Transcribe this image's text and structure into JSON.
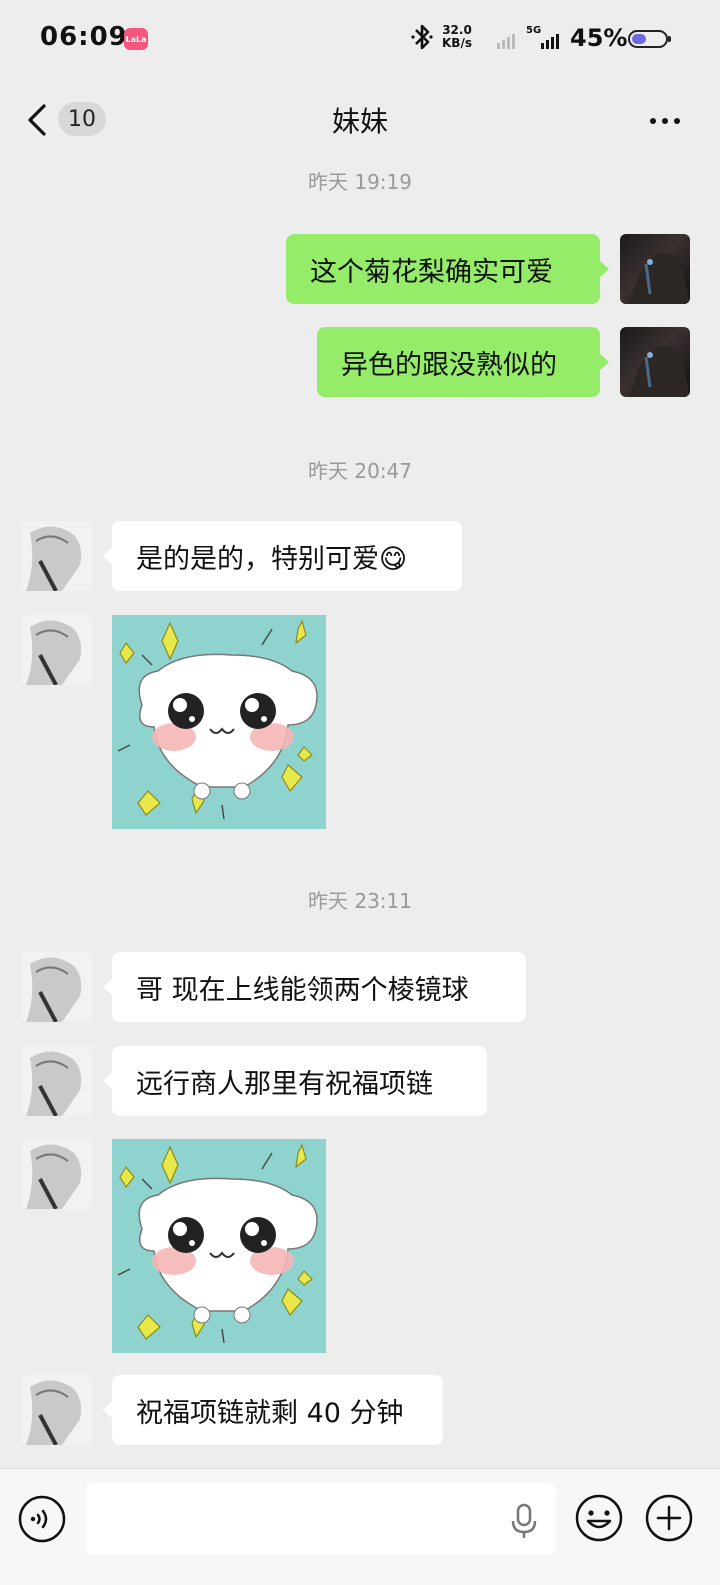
{
  "status_bar": {
    "time": "06:09",
    "app_badge": "LaLa",
    "speed_value": "32.0",
    "speed_unit": "KB/s",
    "network": "5G",
    "battery": "45%",
    "battery_level": 0.45
  },
  "header": {
    "unread_count": "10",
    "title": "妹妹"
  },
  "messages": [
    {
      "type": "time",
      "text": "昨天 19:19"
    },
    {
      "type": "text",
      "side": "out",
      "text": "这个菊花梨确实可爱"
    },
    {
      "type": "text",
      "side": "out",
      "text": "异色的跟没熟似的"
    },
    {
      "type": "time",
      "text": "昨天 20:47"
    },
    {
      "type": "text",
      "side": "in",
      "text": "是的是的，特别可爱😋"
    },
    {
      "type": "sticker",
      "side": "in",
      "sticker": "cute-puppy-sticker"
    },
    {
      "type": "time",
      "text": "昨天 23:11"
    },
    {
      "type": "text",
      "side": "in",
      "text": "哥 现在上线能领两个棱镜球"
    },
    {
      "type": "text",
      "side": "in",
      "text": "远行商人那里有祝福项链"
    },
    {
      "type": "sticker",
      "side": "in",
      "sticker": "cute-puppy-sticker"
    },
    {
      "type": "text",
      "side": "in",
      "text": "祝福项链就剩 40 分钟"
    }
  ],
  "input": {
    "placeholder": ""
  },
  "colors": {
    "background": "#ededed",
    "outgoing_bubble": "#95ec69",
    "incoming_bubble": "#ffffff",
    "timestamp": "#9a9a9a"
  }
}
